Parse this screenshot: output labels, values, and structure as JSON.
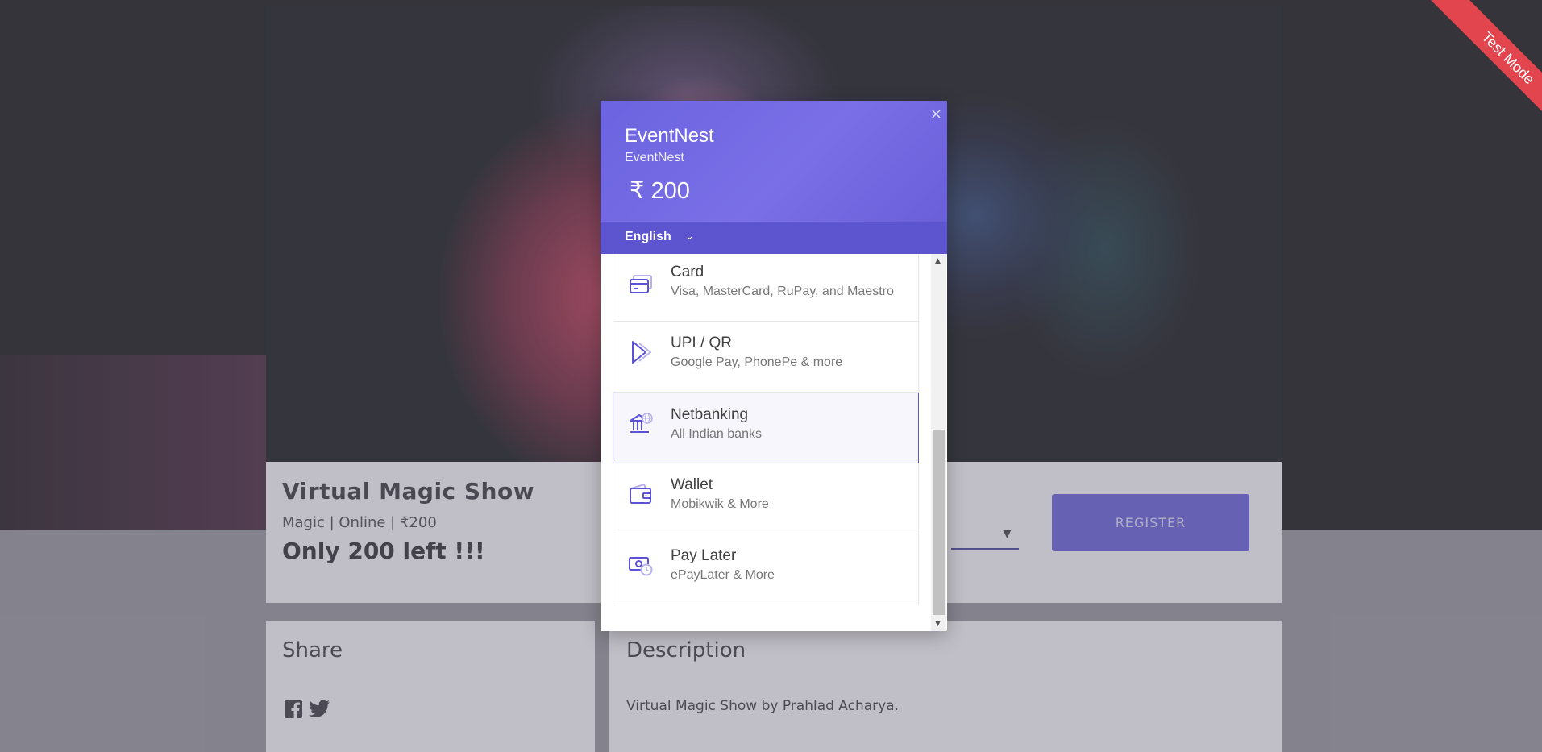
{
  "event": {
    "title": "Virtual Magic Show",
    "meta": "Magic | Online | ₹200",
    "left": "Only 200 left !!!",
    "register_label": "REGISTER",
    "share_title": "Share",
    "description_title": "Description",
    "description_text": "Virtual Magic Show by Prahlad Acharya."
  },
  "ribbon": {
    "label": "Test Mode"
  },
  "checkout": {
    "close": "×",
    "merchant": "EventNest",
    "merchant_sub": "EventNest",
    "amount": "₹ 200",
    "language": "English",
    "methods": [
      {
        "title": "Card",
        "subtitle": "Visa, MasterCard, RuPay, and Maestro",
        "icon": "card-icon"
      },
      {
        "title": "UPI / QR",
        "subtitle": "Google Pay, PhonePe & more",
        "icon": "upi-icon"
      },
      {
        "title": "Netbanking",
        "subtitle": "All Indian banks",
        "icon": "bank-icon"
      },
      {
        "title": "Wallet",
        "subtitle": "Mobikwik & More",
        "icon": "wallet-icon"
      },
      {
        "title": "Pay Later",
        "subtitle": "ePayLater & More",
        "icon": "pay-later-icon"
      }
    ],
    "selected_method": "Netbanking"
  },
  "colors": {
    "accent": "#5b52d8",
    "header": "#6b63e0",
    "ribbon": "#e2454d"
  }
}
